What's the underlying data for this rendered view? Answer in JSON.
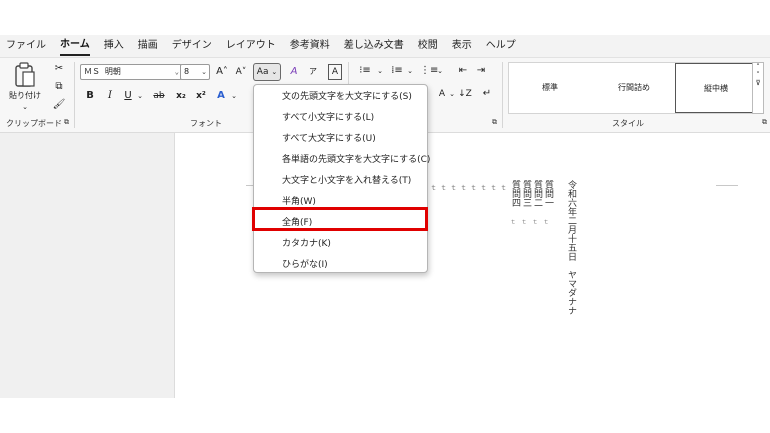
{
  "tabs": [
    "ファイル",
    "ホーム",
    "挿入",
    "描画",
    "デザイン",
    "レイアウト",
    "参考資料",
    "差し込み文書",
    "校閲",
    "表示",
    "ヘルプ"
  ],
  "active_tab": "ホーム",
  "clipboard": {
    "paste_label": "貼り付け",
    "group_label": "クリップボード",
    "launcher": "⧉"
  },
  "font": {
    "name": "ＭＳ 明朝",
    "size": "8",
    "grow": "A˄",
    "shrink": "A˅",
    "change_case": "Aa",
    "clear_format": "A",
    "bold": "B",
    "italic": "I",
    "underline": "U",
    "strike": "ab",
    "subscript": "x₂",
    "superscript": "x²",
    "group_label": "フォント"
  },
  "paragraph": {
    "launcher": "⧉"
  },
  "styles": {
    "items": [
      "標準",
      "行間詰め",
      "縦中横"
    ],
    "selected": "縦中横",
    "group_label": "スタイル",
    "launcher": "⧉"
  },
  "document": {
    "col1": "令和六年二月十五日　ヤマダナナ",
    "col2": "質問一",
    "col3": "質問二",
    "col4": "質問三",
    "col5": "質問四",
    "tmarks": "ｔｔｔｔｔｔｔｔ",
    "smarks": "ｔｔｔｔ"
  },
  "case_menu": {
    "items": [
      "文の先頭文字を大文字にする(S)",
      "すべて小文字にする(L)",
      "すべて大文字にする(U)",
      "各単語の先頭文字を大文字にする(C)",
      "大文字と小文字を入れ替える(T)",
      "半角(W)",
      "全角(F)",
      "カタカナ(K)",
      "ひらがな(I)"
    ],
    "highlighted": "全角(F)",
    "highlight_color": "#e00000"
  }
}
